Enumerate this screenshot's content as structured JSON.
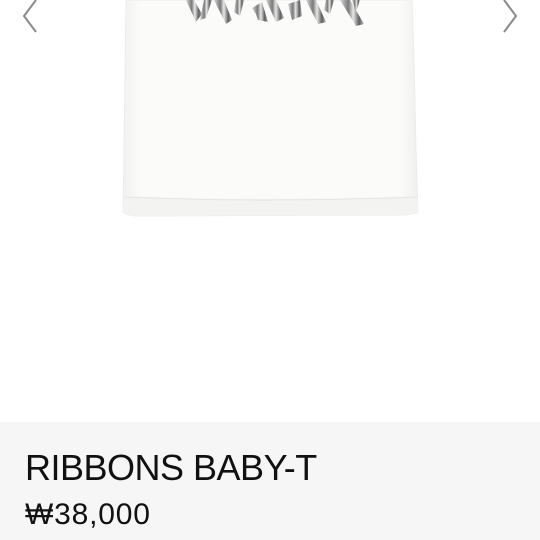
{
  "gallery": {
    "prev_icon": "chevron-left-icon",
    "next_icon": "chevron-right-icon",
    "image_subject": "white t-shirt with silver ribbon lettering"
  },
  "product": {
    "name": "RIBBONS BABY-T",
    "price": "₩38,000"
  },
  "colors": {
    "info_background": "#f6f6f6",
    "text": "#111111",
    "arrow": "#8a8a8a"
  }
}
